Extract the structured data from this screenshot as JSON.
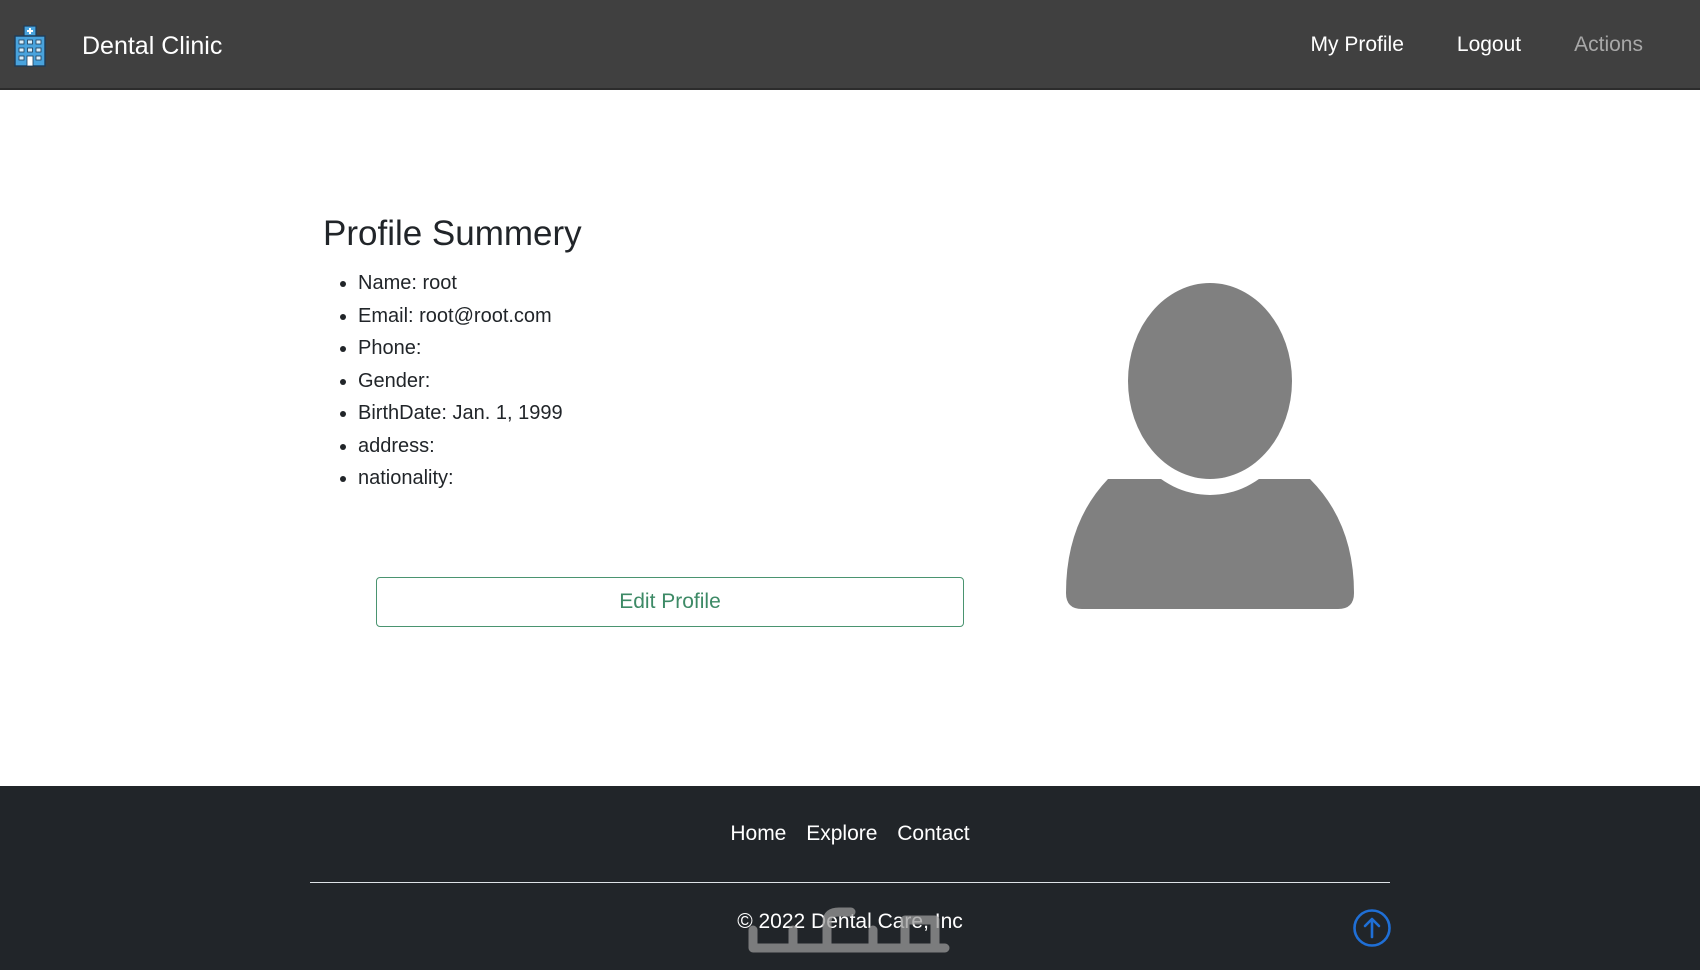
{
  "navbar": {
    "brand": "Dental Clinic",
    "brand_icon": "hospital-building-icon",
    "links": {
      "my_profile": "My Profile",
      "logout": "Logout",
      "actions": "Actions"
    }
  },
  "profile": {
    "title": "Profile Summery",
    "fields": [
      {
        "label": "Name:",
        "value": "root"
      },
      {
        "label": "Email:",
        "value": "root@root.com"
      },
      {
        "label": "Phone:",
        "value": ""
      },
      {
        "label": "Gender:",
        "value": ""
      },
      {
        "label": "BirthDate:",
        "value": "Jan. 1, 1999"
      },
      {
        "label": "address:",
        "value": ""
      },
      {
        "label": "nationality:",
        "value": ""
      }
    ],
    "edit_label": "Edit Profile",
    "avatar_icon": "user-silhouette-icon"
  },
  "footer": {
    "links": {
      "home": "Home",
      "explore": "Explore",
      "contact": "Contact"
    },
    "copyright": "© 2022 Dental Care, Inc",
    "back_to_top_icon": "arrow-up-circle-icon"
  },
  "colors": {
    "navbar_bg": "#404040",
    "footer_bg": "#212529",
    "edit_button_accent": "#3d8a66",
    "back_to_top_accent": "#1f6fd6",
    "avatar_fill": "#808080"
  }
}
